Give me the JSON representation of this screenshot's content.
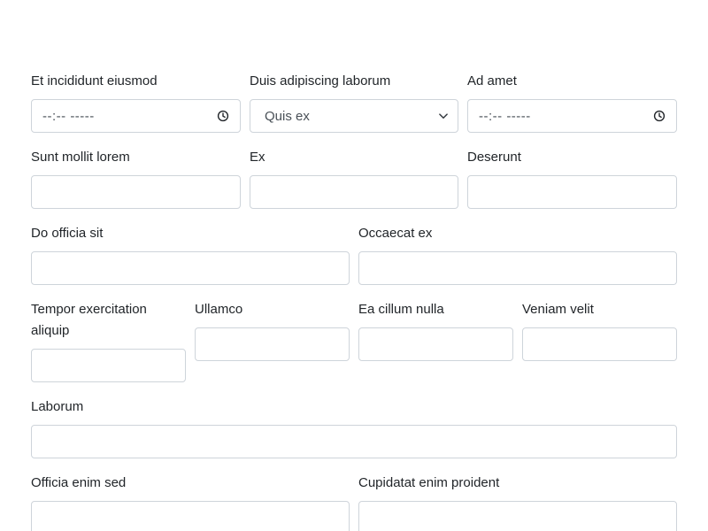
{
  "form": {
    "row1": {
      "field1": {
        "label": "Et incididunt eiusmod",
        "value": "--:-- -----",
        "icon": "clock-icon"
      },
      "field2": {
        "label": "Duis adipiscing laborum",
        "value": "Quis ex",
        "icon": "chevron-down-icon"
      },
      "field3": {
        "label": "Ad amet",
        "value": "--:-- -----",
        "icon": "clock-icon"
      }
    },
    "row2": {
      "field1": {
        "label": "Sunt mollit lorem",
        "value": ""
      },
      "field2": {
        "label": "Ex",
        "value": ""
      },
      "field3": {
        "label": "Deserunt",
        "value": ""
      }
    },
    "row3": {
      "field1": {
        "label": "Do officia sit",
        "value": ""
      },
      "field2": {
        "label": "Occaecat ex",
        "value": ""
      }
    },
    "row4": {
      "field1": {
        "label_line1": "Tempor exercitation",
        "label_line2": "aliquip",
        "value": ""
      },
      "field2": {
        "label": "Ullamco",
        "value": ""
      },
      "field3": {
        "label": "Ea cillum nulla",
        "value": ""
      },
      "field4": {
        "label": "Veniam velit",
        "value": ""
      }
    },
    "row5": {
      "field1": {
        "label": "Laborum",
        "value": ""
      }
    },
    "row6": {
      "field1": {
        "label": "Officia enim sed",
        "value": ""
      },
      "field2": {
        "label": "Cupidatat enim proident",
        "value": ""
      }
    }
  },
  "colors": {
    "border": "#ced4da",
    "text": "#212529",
    "value_text": "#495057"
  }
}
